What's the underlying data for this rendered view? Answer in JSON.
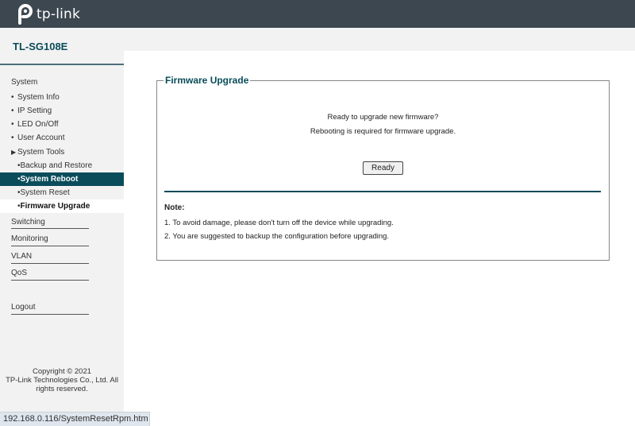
{
  "header": {
    "logo_text": "tp-link",
    "model": "TL-SG108E"
  },
  "sidebar": {
    "system": "System",
    "system_items": [
      "System Info",
      "IP Setting",
      "LED On/Off",
      "User Account"
    ],
    "system_tools": "System Tools",
    "tools_items": [
      "Backup and Restore",
      "System Reboot",
      "System Reset",
      "Firmware Upgrade"
    ],
    "switching": "Switching",
    "monitoring": "Monitoring",
    "vlan": "VLAN",
    "qos": "QoS",
    "logout": "Logout",
    "copyright_line1": "Copyright © 2021",
    "copyright_line2": "TP-Link Technologies Co., Ltd. All",
    "copyright_line3": "rights reserved."
  },
  "main": {
    "legend": "Firmware Upgrade",
    "msg1": "Ready to upgrade new firmware?",
    "msg2": "Rebooting is required for firmware upgrade.",
    "button": "Ready",
    "note_title": "Note:",
    "note1": "1. To avoid damage, please don't turn off the device while upgrading.",
    "note2": "2. You are suggested to backup the configuration before upgrading."
  },
  "status": {
    "url": "192.168.0.116/SystemResetRpm.htm"
  },
  "colors": {
    "topbar": "#3c474f",
    "accent": "#0a4c5a",
    "sidebar_bg": "#f2f2f2"
  }
}
